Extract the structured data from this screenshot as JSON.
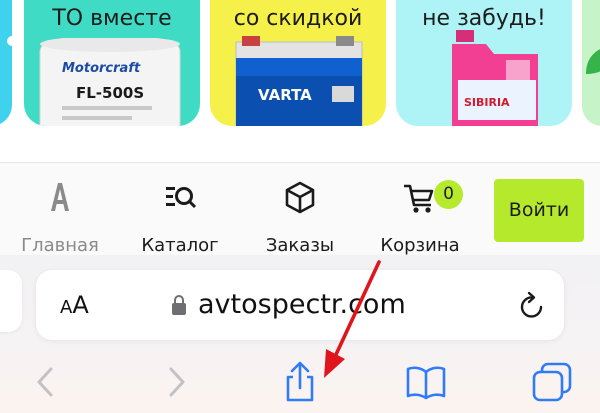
{
  "banner": {
    "cards": [
      {
        "line": "ТО вместе"
      },
      {
        "line": "со скидкой"
      },
      {
        "line": "не забудь!"
      }
    ],
    "products": {
      "filter_brand": "Motorcraft",
      "filter_model": "FL-500S",
      "battery_brand": "VARTA",
      "coolant_brand": "SIBIRIA"
    }
  },
  "nav": {
    "home_label": "Главная",
    "catalog_label": "Каталог",
    "orders_label": "Заказы",
    "cart_label": "Корзина",
    "cart_count": "0",
    "login_label": "Войти"
  },
  "browser": {
    "aa_label_big": "A",
    "aa_label_small": "A",
    "url": "avtospectr.com"
  },
  "colors": {
    "accent_green": "#b4ea2b",
    "safari_blue": "#2f7cf6",
    "annotation_red": "#e0151b"
  },
  "icons": {
    "home": "letter-a-icon",
    "catalog": "catalog-search-icon",
    "orders": "box-icon",
    "cart": "cart-icon",
    "lock": "lock-icon",
    "reload": "reload-icon",
    "back": "chevron-left-icon",
    "forward": "chevron-right-icon",
    "share": "share-icon",
    "bookmarks": "book-icon",
    "tabs": "tabs-icon"
  }
}
